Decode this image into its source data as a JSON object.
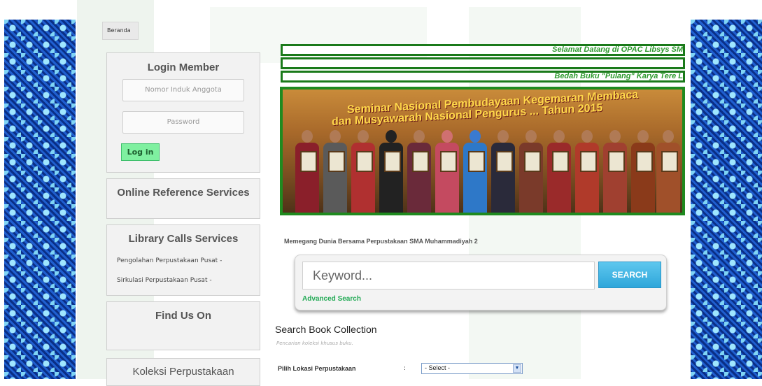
{
  "breadcrumb": {
    "home": "Beranda"
  },
  "login": {
    "title": "Login Member",
    "member_placeholder": "Nomor Induk Anggota",
    "password_placeholder": "Password",
    "button": "Log in"
  },
  "sidebar": {
    "online_reference": "Online Reference Services",
    "library_calls": {
      "title": "Library Calls Services",
      "items": [
        "Pengolahan Perpustakaan Pusat -",
        "Sirkulasi Perpustakaan Pusat -"
      ]
    },
    "find_us": "Find Us On",
    "koleksi": "Koleksi Perpustakaan"
  },
  "marquees": {
    "welcome": "Selamat Datang di OPAC Libsys SM",
    "news": "Bedah Buku \"Pulang\" Karya Tere L"
  },
  "banner": {
    "line1": "Seminar Nasional Pembudayaan Kegemaran Membaca",
    "line2": "dan Musyawarah Nasional Pengurus ... Tahun 2015"
  },
  "tagline": "Memegang Dunia Bersama Perpustakaan SMA Muhammadiyah 2",
  "search": {
    "placeholder": "Keyword...",
    "button": "SEARCH",
    "advanced": "Advanced Search"
  },
  "collection": {
    "title": "Search Book Collection",
    "subtitle": "Pencarian koleksi khusus buku.",
    "location_label": "Pilih Lokasi Perpustakaan",
    "separator": ":",
    "select_value": "- Select -"
  },
  "colors": {
    "accent_green": "#1f8a1f",
    "search_blue": "#2ea6da",
    "login_green": "#7ff0a0"
  }
}
